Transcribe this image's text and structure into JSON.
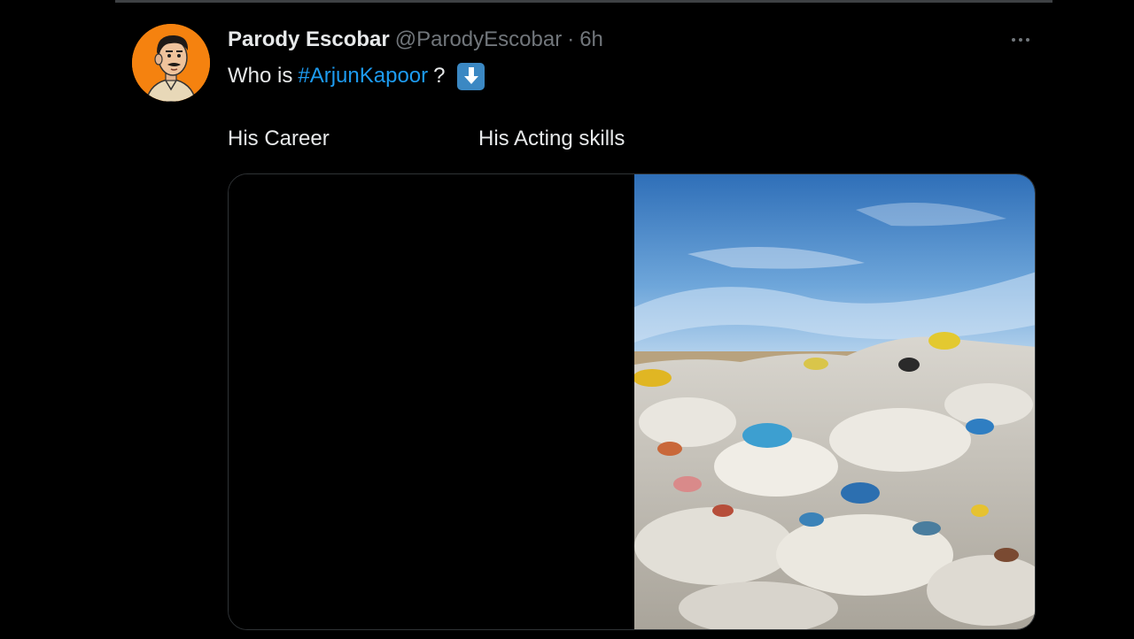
{
  "tweet": {
    "display_name": "Parody Escobar",
    "handle": "@ParodyEscobar",
    "separator": "·",
    "time": "6h",
    "text_prefix": "Who is",
    "hashtag": "#ArjunKapoor",
    "text_suffix": "?",
    "emoji": "down-arrow-icon",
    "caption_left": "His Career",
    "caption_right": "His Acting skills"
  },
  "colors": {
    "background": "#000000",
    "text": "#e7e9ea",
    "muted": "#71767b",
    "link": "#1d9bf0",
    "avatar_bg": "#f5820f",
    "emoji_bg": "#3b88c3"
  }
}
